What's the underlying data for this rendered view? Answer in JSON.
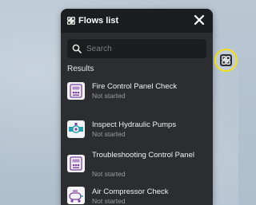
{
  "panel": {
    "title": "Flows list",
    "title_icon": "flows-icon",
    "close_icon": "close-icon"
  },
  "search": {
    "placeholder": "Search",
    "value": "",
    "icon": "search-icon"
  },
  "results_label": "Results",
  "flows": [
    {
      "name": "Fire Control Panel Check",
      "status": "Not started",
      "icon": "control-panel-icon",
      "color": "#7b3fa0"
    },
    {
      "name": "Inspect Hydraulic Pumps",
      "status": "Not started",
      "icon": "hydraulic-pump-icon",
      "color": "#2a9fb0"
    },
    {
      "name": "Troubleshooting Control Panel",
      "status": "Not started",
      "icon": "control-panel-icon",
      "color": "#7b3fa0"
    },
    {
      "name": "Air Compressor Check",
      "status": "Not started",
      "icon": "air-compressor-icon",
      "color": "#7b3fa0"
    }
  ],
  "side_button": {
    "icon": "flows-icon",
    "highlight_color": "#f2df1a"
  },
  "colors": {
    "panel_background": "#2b2d31",
    "header_background": "#1c1d20",
    "text_primary": "#f2f2f2",
    "text_secondary": "#9a9ca1"
  }
}
